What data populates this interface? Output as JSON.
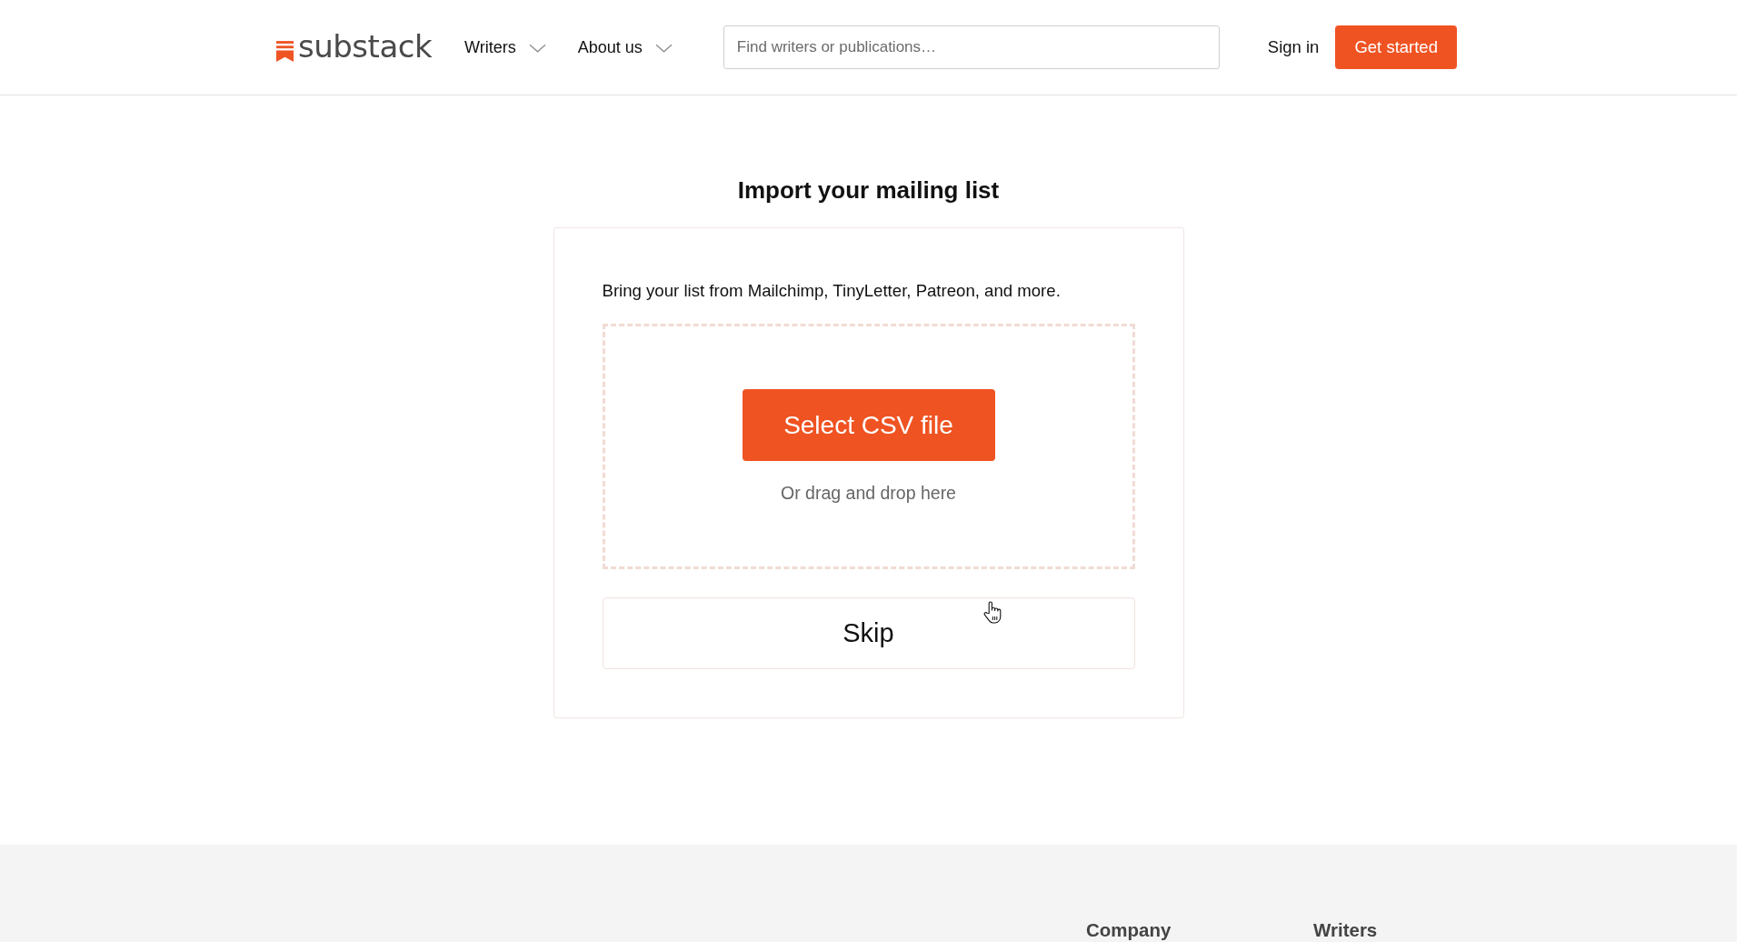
{
  "header": {
    "logo": "substack",
    "nav": [
      {
        "label": "Writers"
      },
      {
        "label": "About us"
      }
    ],
    "search": {
      "placeholder": "Find writers or publications…"
    },
    "sign_in": "Sign in",
    "get_started": "Get started"
  },
  "main": {
    "title": "Import your mailing list",
    "description": "Bring your list from Mailchimp, TinyLetter, Patreon, and more.",
    "dropzone": {
      "button": "Select CSV file",
      "hint": "Or drag and drop here"
    },
    "skip": "Skip"
  },
  "footer": {
    "columns": [
      {
        "heading": "Company"
      },
      {
        "heading": "Writers"
      }
    ]
  }
}
